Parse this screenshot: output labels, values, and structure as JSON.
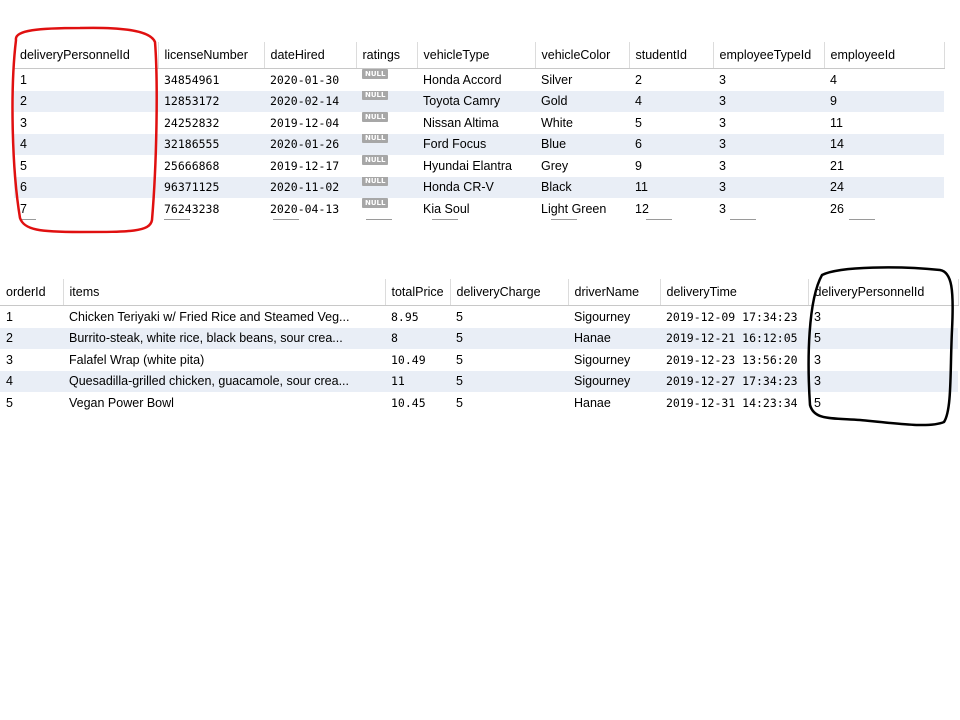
{
  "table1": {
    "columns": [
      "deliveryPersonnelId",
      "licenseNumber",
      "dateHired",
      "ratings",
      "vehicleType",
      "vehicleColor",
      "studentId",
      "employeeTypeId",
      "employeeId"
    ],
    "rows": [
      [
        "1",
        "34854961",
        "2020-01-30",
        "NULL",
        "Honda Accord",
        "Silver",
        "2",
        "3",
        "4"
      ],
      [
        "2",
        "12853172",
        "2020-02-14",
        "NULL",
        "Toyota Camry",
        "Gold",
        "4",
        "3",
        "9"
      ],
      [
        "3",
        "24252832",
        "2019-12-04",
        "NULL",
        "Nissan Altima",
        "White",
        "5",
        "3",
        "11"
      ],
      [
        "4",
        "32186555",
        "2020-01-26",
        "NULL",
        "Ford Focus",
        "Blue",
        "6",
        "3",
        "14"
      ],
      [
        "5",
        "25666868",
        "2019-12-17",
        "NULL",
        "Hyundai Elantra",
        "Grey",
        "9",
        "3",
        "21"
      ],
      [
        "6",
        "96371125",
        "2020-11-02",
        "NULL",
        "Honda CR-V",
        "Black",
        "11",
        "3",
        "24"
      ],
      [
        "7",
        "76243238",
        "2020-04-13",
        "NULL",
        "Kia Soul",
        "Light Green",
        "12",
        "3",
        "26"
      ]
    ]
  },
  "table2": {
    "columns": [
      "orderId",
      "items",
      "totalPrice",
      "deliveryCharge",
      "driverName",
      "deliveryTime",
      "deliveryPersonnelId"
    ],
    "rows": [
      [
        "1",
        "Chicken Teriyaki w/ Fried Rice and Steamed Veg...",
        "8.95",
        "5",
        "Sigourney",
        "2019-12-09 17:34:23",
        "3"
      ],
      [
        "2",
        "Burrito-steak, white rice, black beans, sour crea...",
        "8",
        "5",
        "Hanae",
        "2019-12-21 16:12:05",
        "5"
      ],
      [
        "3",
        "Falafel Wrap (white pita)",
        "10.49",
        "5",
        "Sigourney",
        "2019-12-23 13:56:20",
        "3"
      ],
      [
        "4",
        "Quesadilla-grilled chicken, guacamole, sour crea...",
        "11",
        "5",
        "Sigourney",
        "2019-12-27 17:34:23",
        "3"
      ],
      [
        "5",
        "Vegan Power Bowl",
        "10.45",
        "5",
        "Hanae",
        "2019-12-31 14:23:34",
        "5"
      ]
    ]
  },
  "colors": {
    "row_stripe": "#e9eef6",
    "annotation_red": "#e01010",
    "annotation_black": "#000000",
    "null_badge": "#a7a7a7"
  }
}
